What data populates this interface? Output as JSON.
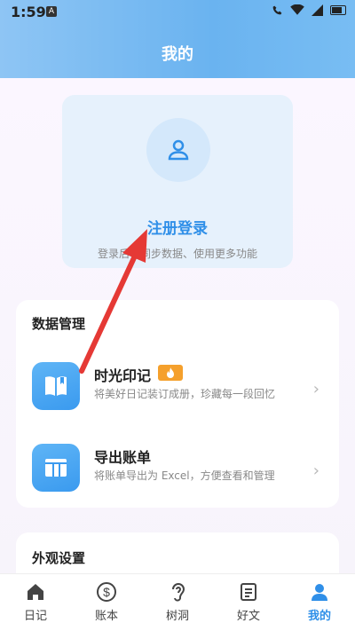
{
  "status_bar": {
    "time": "1:59",
    "notif_icon": "A"
  },
  "header": {
    "title": "我的"
  },
  "login": {
    "link": "注册登录",
    "subtitle": "登录后可同步数据、使用更多功能"
  },
  "data_section": {
    "title": "数据管理",
    "items": [
      {
        "title": "时光印记",
        "desc": "将美好日记装订成册，珍藏每一段回忆",
        "icon": "book-icon"
      },
      {
        "title": "导出账单",
        "desc": "将账单导出为 Excel，方便查看和管理",
        "icon": "table-icon"
      }
    ]
  },
  "appearance": {
    "title": "外观设置"
  },
  "tabs": [
    {
      "label": "日记",
      "icon": "home-icon"
    },
    {
      "label": "账本",
      "icon": "dollar-icon"
    },
    {
      "label": "树洞",
      "icon": "ear-icon"
    },
    {
      "label": "好文",
      "icon": "document-icon"
    },
    {
      "label": "我的",
      "icon": "person-icon",
      "active": true
    }
  ],
  "colors": {
    "accent": "#2f8fe8",
    "annotation_arrow": "#e53935",
    "badge": "#f5a02c"
  }
}
